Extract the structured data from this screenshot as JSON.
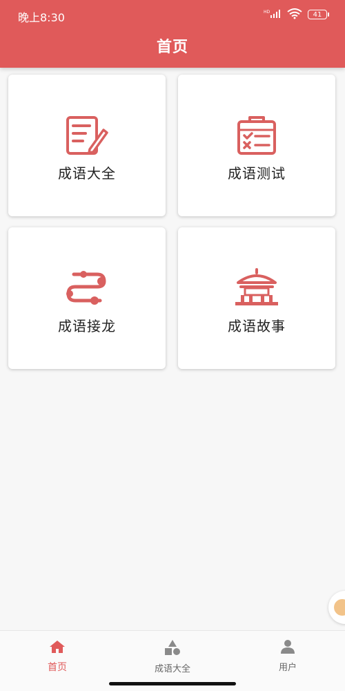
{
  "status_bar": {
    "time": "晚上8:30",
    "hd_label": "HD",
    "battery": "41"
  },
  "header": {
    "title": "首页"
  },
  "cards": [
    {
      "label": "成语大全",
      "icon": "notebook-pen-icon"
    },
    {
      "label": "成语测试",
      "icon": "checklist-clipboard-icon"
    },
    {
      "label": "成语接龙",
      "icon": "chain-path-icon"
    },
    {
      "label": "成语故事",
      "icon": "pavilion-icon"
    }
  ],
  "tabbar": {
    "items": [
      {
        "label": "首页",
        "icon": "home-icon",
        "active": true
      },
      {
        "label": "成语大全",
        "icon": "shapes-icon",
        "active": false
      },
      {
        "label": "用户",
        "icon": "user-icon",
        "active": false
      }
    ]
  },
  "colors": {
    "accent": "#e05a5a",
    "icon": "#d9605f",
    "inactive_icon": "#8a8a8a"
  }
}
